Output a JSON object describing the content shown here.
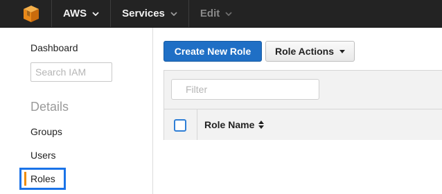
{
  "topbar": {
    "logo_icon": "aws-cube-icon",
    "items": [
      {
        "label": "AWS",
        "enabled": true
      },
      {
        "label": "Services",
        "enabled": true
      },
      {
        "label": "Edit",
        "enabled": false
      }
    ]
  },
  "sidebar": {
    "dashboard": "Dashboard",
    "search_placeholder": "Search IAM",
    "details_heading": "Details",
    "groups": "Groups",
    "users": "Users",
    "roles": "Roles"
  },
  "toolbar": {
    "create_label": "Create New Role",
    "actions_label": "Role Actions"
  },
  "table": {
    "filter_placeholder": "Filter",
    "columns": [
      "Role Name"
    ]
  },
  "colors": {
    "nav_bg": "#232323",
    "primary": "#1f6fc5",
    "highlight": "#1a73e8",
    "accent": "#f08c00"
  }
}
